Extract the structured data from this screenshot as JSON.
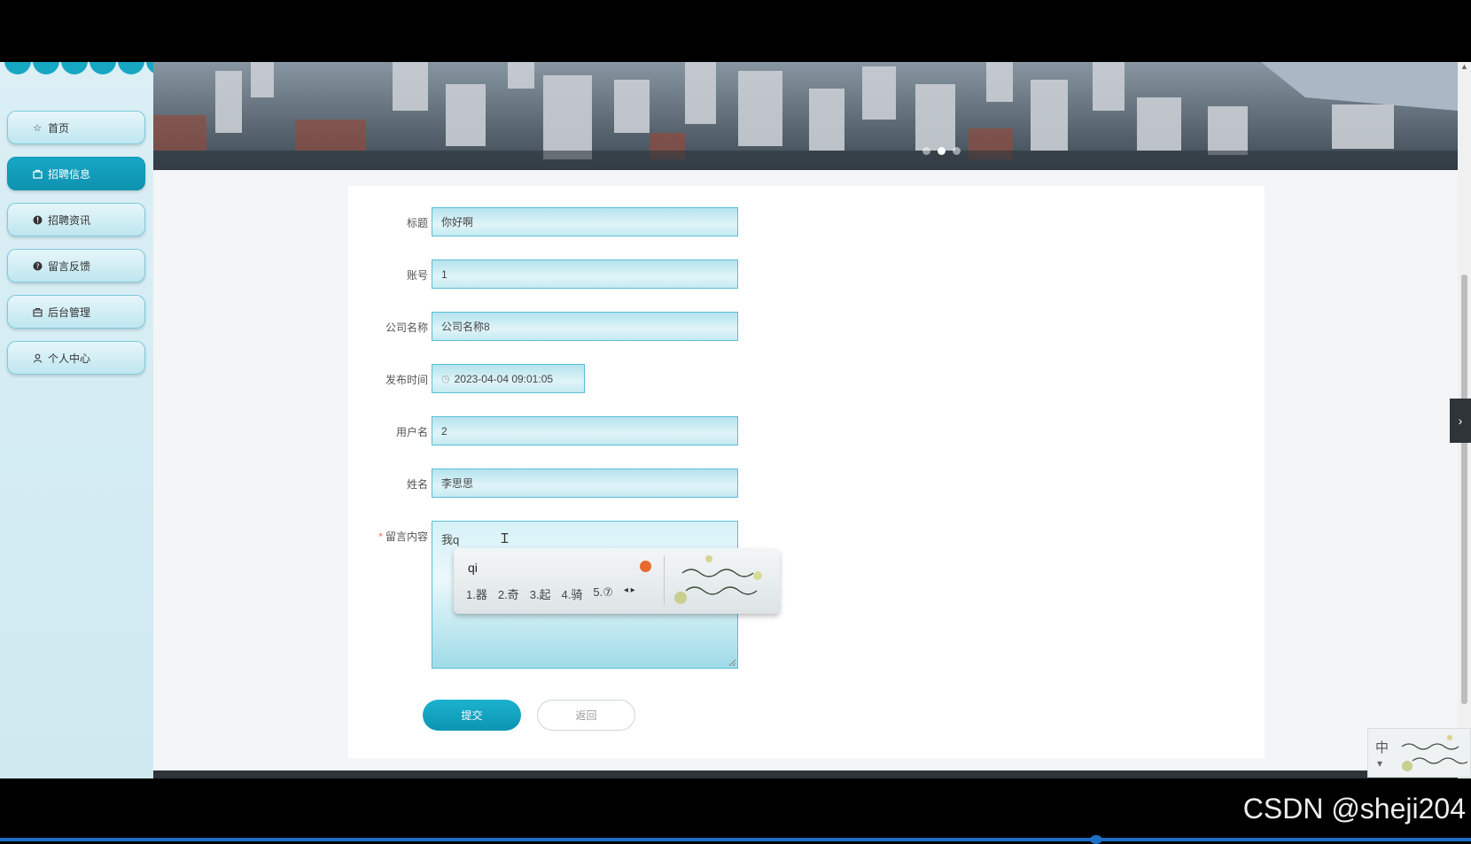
{
  "sidebar": {
    "items": [
      {
        "label": "首页",
        "icon": "star-icon"
      },
      {
        "label": "招聘信息",
        "icon": "bag-icon",
        "active": true
      },
      {
        "label": "招聘资讯",
        "icon": "info-icon"
      },
      {
        "label": "留言反馈",
        "icon": "help-icon"
      },
      {
        "label": "后台管理",
        "icon": "suitcase-icon"
      },
      {
        "label": "个人中心",
        "icon": "user-icon"
      }
    ]
  },
  "form": {
    "title": {
      "label": "标题",
      "value": "你好啊"
    },
    "account": {
      "label": "账号",
      "value": "1"
    },
    "company": {
      "label": "公司名称",
      "value": "公司名称8"
    },
    "publish_time": {
      "label": "发布时间",
      "value": "2023-04-04 09:01:05"
    },
    "username": {
      "label": "用户名",
      "value": "2"
    },
    "realname": {
      "label": "姓名",
      "value": "李思思"
    },
    "message": {
      "label": "留言内容",
      "required_mark": "*",
      "value": "我q"
    }
  },
  "ime": {
    "composition": "qi",
    "candidates": [
      "1.器",
      "2.奇",
      "3.起",
      "4.骑",
      "5.⑦"
    ]
  },
  "buttons": {
    "submit": "提交",
    "back": "返回"
  },
  "widget": {
    "lang": "中"
  },
  "watermark": "CSDN @sheji204",
  "colors": {
    "accent": "#0e93b0",
    "field_border": "#58bfd6"
  }
}
